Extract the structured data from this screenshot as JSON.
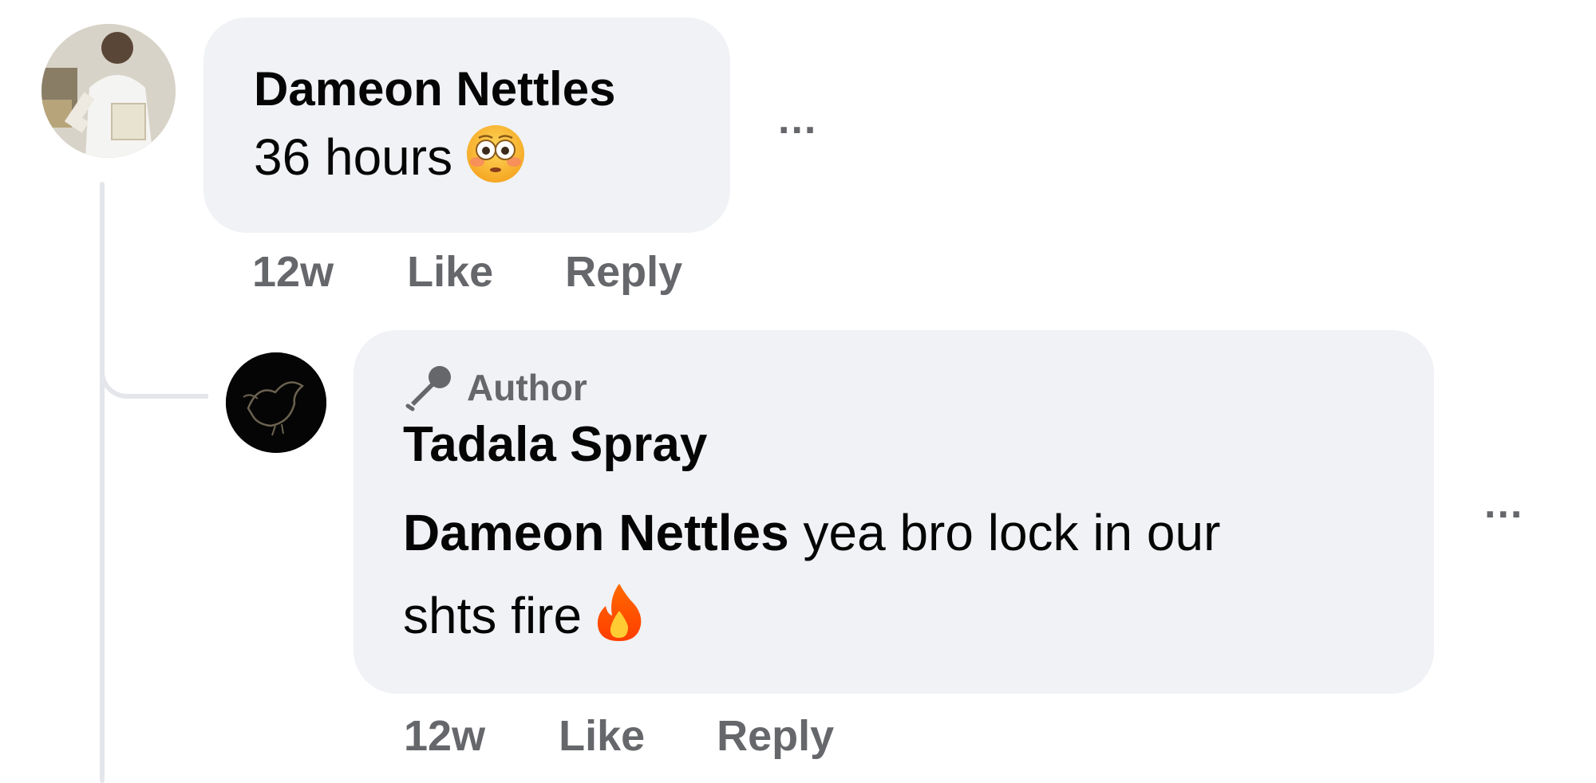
{
  "thread": {
    "comment": {
      "author": "Dameon Nettles",
      "text": "36 hours",
      "emoji": "flushed-face",
      "timestamp": "12w",
      "like_label": "Like",
      "reply_label": "Reply",
      "more_label": "..."
    },
    "reply": {
      "badge": "Author",
      "author": "Tadala Spray",
      "mention": "Dameon Nettles",
      "text": " yea bro lock in our shts fire",
      "emoji": "fire",
      "timestamp": "12w",
      "like_label": "Like",
      "reply_label": "Reply",
      "more_label": "..."
    }
  },
  "colors": {
    "bubble": "#f0f2f5",
    "secondary_text": "#65676b",
    "primary_text": "#050505",
    "thread_line": "#e4e6eb"
  }
}
